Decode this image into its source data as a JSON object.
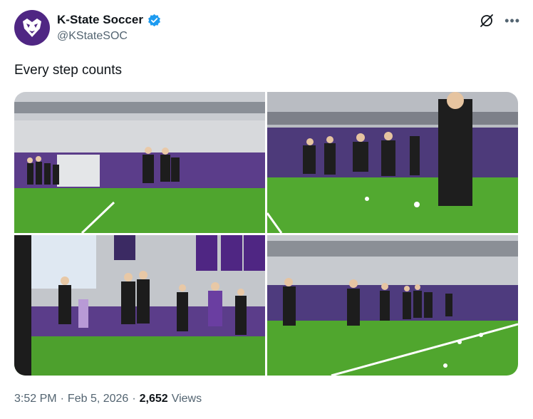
{
  "author": {
    "display_name": "K-State Soccer",
    "handle": "@KStateSOC",
    "verified": true,
    "avatar_icon": "wildcat-logo-icon",
    "brand_color": "#4f2683"
  },
  "tweet": {
    "text": "Every step counts"
  },
  "media": {
    "photos": [
      {
        "description_icon": "photo-icon"
      },
      {
        "description_icon": "photo-icon"
      },
      {
        "description_icon": "photo-icon"
      },
      {
        "description_icon": "photo-icon"
      }
    ]
  },
  "meta": {
    "time": "3:52 PM",
    "separator": "·",
    "date": "Feb 5, 2026",
    "views_count": "2,652",
    "views_label": "Views"
  },
  "colors": {
    "text": "#0f1419",
    "secondary": "#536471",
    "verified_blue": "#1d9bf0"
  }
}
